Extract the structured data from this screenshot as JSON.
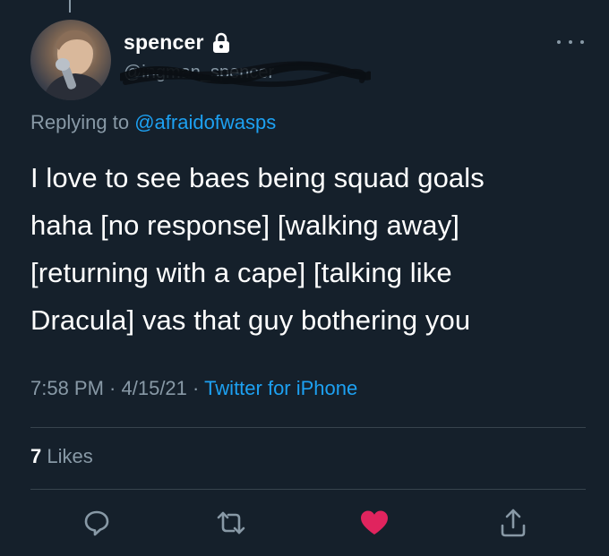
{
  "colors": {
    "background": "#15202b",
    "text": "#ffffff",
    "muted": "#8899a6",
    "link": "#1da1f2",
    "like": "#e0245e",
    "divider": "#38444d"
  },
  "author": {
    "display_name": "spencer",
    "handle": "@ingman_spencer",
    "protected_icon": "lock-icon",
    "avatar_icon": "avatar-photo"
  },
  "reply": {
    "prefix": "Replying to",
    "mention": "@afraidofwasps"
  },
  "tweet": {
    "lines": [
      "I love to see baes being squad goals",
      "haha [no response] [walking away]",
      "[returning with a cape] [talking like",
      "Dracula] vas that guy bothering you"
    ]
  },
  "meta": {
    "time": "7:58 PM",
    "separator": " · ",
    "date": "4/15/21",
    "source": "Twitter for iPhone"
  },
  "stats": {
    "likes_count": "7",
    "likes_label": "Likes"
  },
  "actions": {
    "reply_icon": "reply-icon",
    "retweet_icon": "retweet-icon",
    "like_icon": "heart-icon",
    "like_active": true,
    "share_icon": "share-icon"
  },
  "menu": {
    "more_icon": "more-icon"
  }
}
